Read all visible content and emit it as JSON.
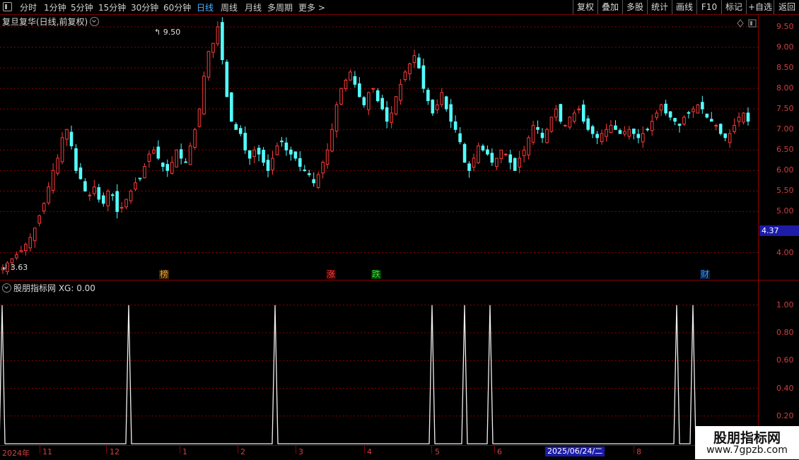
{
  "toolbar": {
    "periods": [
      "分时",
      "1分钟",
      "5分钟",
      "15分钟",
      "30分钟",
      "60分钟",
      "日线",
      "周线",
      "月线",
      "多周期",
      "更多 >"
    ],
    "active_period": "日线",
    "right_buttons": [
      "复权",
      "叠加",
      "多股",
      "统计",
      "画线",
      "F10",
      "标记",
      "+自选",
      "返回"
    ]
  },
  "main": {
    "title": "复旦复华(日线,前复权)",
    "high_label": "9.50",
    "low_label": "3.63",
    "current_price_tag": "4.37",
    "y_ticks": [
      "9.50",
      "9.00",
      "8.50",
      "8.00",
      "7.50",
      "7.00",
      "6.50",
      "6.00",
      "5.50",
      "5.00",
      "4.00"
    ],
    "events": [
      {
        "text": "榜",
        "color": "#e0a040"
      },
      {
        "text": "涨",
        "color": "#ff4040"
      },
      {
        "text": "跌",
        "color": "#40e040"
      },
      {
        "text": "财",
        "color": "#4090ff"
      }
    ]
  },
  "indicator": {
    "title": "股朋指标网 XG: 0.00",
    "y_ticks": [
      "1.00",
      "0.80",
      "0.60",
      "0.40",
      "0.20"
    ]
  },
  "date_axis": {
    "labels": [
      "2024年",
      "11",
      "12",
      "1",
      "2",
      "3",
      "4",
      "5",
      "6",
      "2025/06/24/二",
      "8"
    ]
  },
  "watermark": {
    "line1": "股朋指标网",
    "line2": "www.7gpzb.com"
  },
  "colors": {
    "up": "#ff3b3b",
    "down": "#54ffff",
    "grid": "#8b0000",
    "active": "#4fb0ff"
  },
  "chart_data": {
    "type": "candlestick",
    "price_axis_range": [
      3.5,
      9.7
    ],
    "close_sequence": [
      3.63,
      3.75,
      3.85,
      3.95,
      4.05,
      4.2,
      4.37,
      4.6,
      4.9,
      5.2,
      5.6,
      6.0,
      6.3,
      6.8,
      7.0,
      6.6,
      6.0,
      5.8,
      5.5,
      5.4,
      5.6,
      5.3,
      5.2,
      5.5,
      5.4,
      5.0,
      5.1,
      5.3,
      5.5,
      5.7,
      5.8,
      6.1,
      6.4,
      6.5,
      6.3,
      6.1,
      6.0,
      6.2,
      6.5,
      6.3,
      6.2,
      6.6,
      7.0,
      7.5,
      8.3,
      8.9,
      9.1,
      9.5,
      8.7,
      7.8,
      7.2,
      7.0,
      6.9,
      6.5,
      6.3,
      6.5,
      6.4,
      6.2,
      6.0,
      6.3,
      6.6,
      6.7,
      6.5,
      6.4,
      6.3,
      6.1,
      6.0,
      5.9,
      5.7,
      5.9,
      6.2,
      6.5,
      7.0,
      7.6,
      8.0,
      8.2,
      8.4,
      8.1,
      7.8,
      7.6,
      7.9,
      8.0,
      7.7,
      7.5,
      7.2,
      7.4,
      7.8,
      8.1,
      8.4,
      8.6,
      8.8,
      8.5,
      8.0,
      7.7,
      7.4,
      7.6,
      7.9,
      7.5,
      7.2,
      7.0,
      6.7,
      6.2,
      6.0,
      6.3,
      6.6,
      6.5,
      6.4,
      6.2,
      6.3,
      6.5,
      6.4,
      6.2,
      6.0,
      6.3,
      6.5,
      6.8,
      7.1,
      7.0,
      6.8,
      7.0,
      7.3,
      7.5,
      7.2,
      7.1,
      7.3,
      7.4,
      7.5,
      7.2,
      7.0,
      6.9,
      6.8,
      6.9,
      7.0,
      7.1,
      7.0,
      6.9,
      6.95,
      7.0,
      6.9,
      6.8,
      6.9,
      7.0,
      7.2,
      7.4,
      7.6,
      7.4,
      7.3,
      7.2,
      7.1,
      7.3,
      7.4,
      7.5,
      7.6,
      7.5,
      7.3,
      7.2,
      7.1,
      6.9,
      6.8,
      6.9,
      7.1,
      7.3,
      7.4,
      7.2
    ],
    "xg_signal_count": 8
  }
}
